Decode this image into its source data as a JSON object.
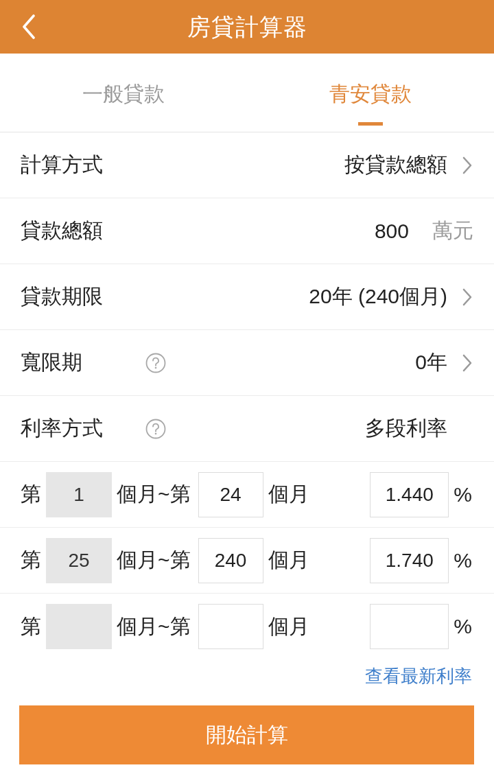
{
  "header": {
    "title": "房貸計算器"
  },
  "tabs": [
    {
      "label": "一般貸款",
      "selected": false
    },
    {
      "label": "青安貸款",
      "selected": true
    }
  ],
  "settings": [
    {
      "kind": "select",
      "label": "計算方式",
      "help": false,
      "value": "按貸款總額"
    },
    {
      "kind": "input",
      "label": "貸款總額",
      "help": false,
      "value": "800",
      "unit": "萬元"
    },
    {
      "kind": "select",
      "label": "貸款期限",
      "help": false,
      "value": "20年 (240個月)"
    },
    {
      "kind": "select",
      "label": "寬限期",
      "help": true,
      "value": "0年"
    },
    {
      "kind": "text",
      "label": "利率方式",
      "help": true,
      "value": "多段利率"
    }
  ],
  "rate_tiers": [
    {
      "start_label": "第",
      "start": {
        "value": "1",
        "disabled": true
      },
      "range_label": "個月~第",
      "end": {
        "value": "24",
        "disabled": false
      },
      "end_label": "個月",
      "rate": {
        "value": "1.440",
        "disabled": false
      },
      "unit": "%"
    },
    {
      "start_label": "第",
      "start": {
        "value": "25",
        "disabled": true
      },
      "range_label": "個月~第",
      "end": {
        "value": "240",
        "disabled": false
      },
      "end_label": "個月",
      "rate": {
        "value": "1.740",
        "disabled": false
      },
      "unit": "%"
    },
    {
      "start_label": "第",
      "start": {
        "disabled": true
      },
      "range_label": "個月~第",
      "end": {
        "disabled": false
      },
      "end_label": "個月",
      "rate": {
        "disabled": false
      },
      "unit": "%"
    }
  ],
  "rates_link": "查看最新利率",
  "calculate_button": "開始計算"
}
